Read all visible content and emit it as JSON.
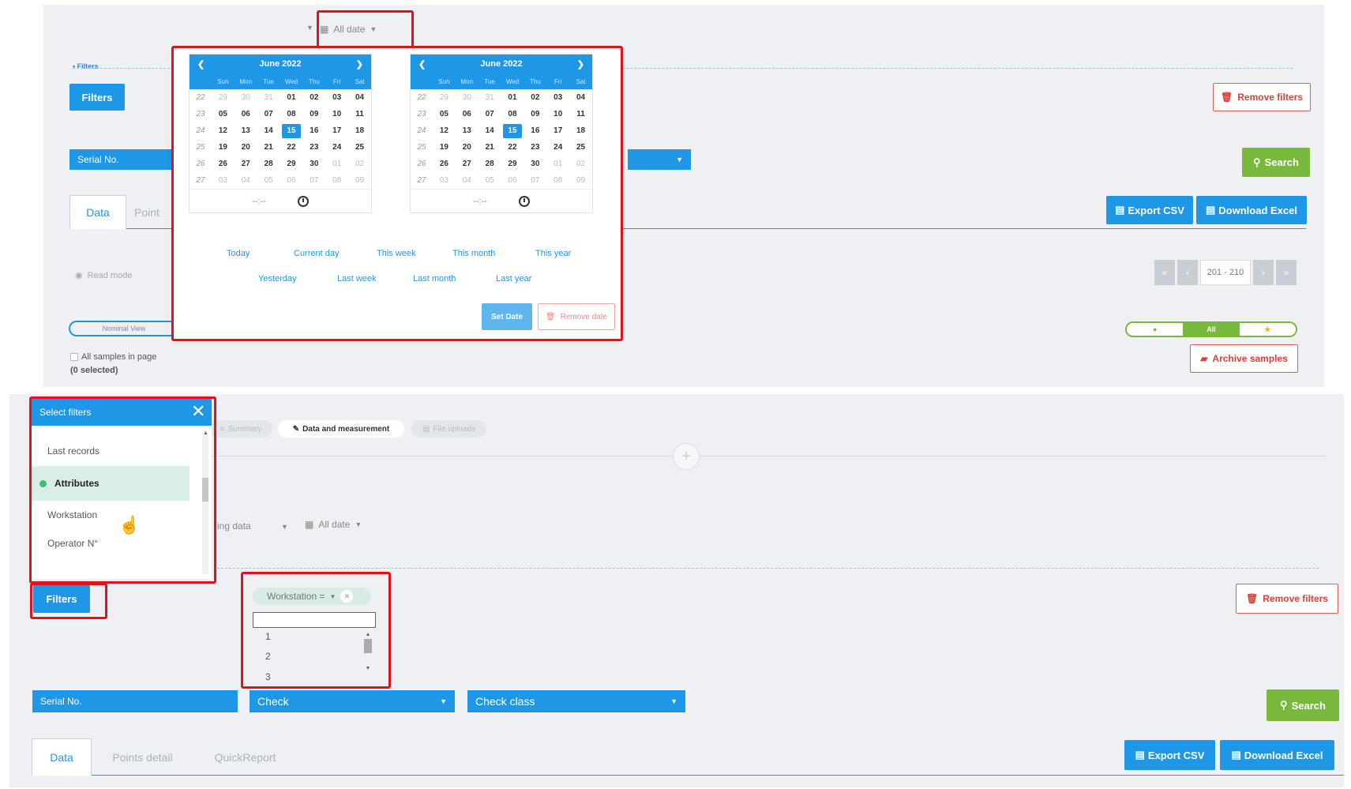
{
  "top": {
    "date_dropdown": "All date",
    "filters_caption": "• Filters",
    "filters_button": "Filters",
    "remove_filters": "Remove filters",
    "serial_no": "Serial No.",
    "search": "Search",
    "tabs": [
      "Data",
      "Point"
    ],
    "export_csv": "Export CSV",
    "download_excel": "Download Excel",
    "read_mode": "Read mode",
    "pagination": "201 - 210",
    "view_toggle": "Nominal View",
    "all_samples": "All samples in page",
    "selected_count": "(0 selected)",
    "archive_samples": "Archive samples",
    "segment": {
      "left": "●",
      "middle": "All",
      "right": "★"
    }
  },
  "calendars": [
    {
      "month": "June 2022"
    },
    {
      "month": "June 2022"
    }
  ],
  "weekday_labels": [
    "Sun",
    "Mon",
    "Tue",
    "Wed",
    "Thu",
    "Fri",
    "Sat"
  ],
  "calendar_rows": [
    {
      "wk": "22",
      "days": [
        "29",
        "30",
        "31",
        "01",
        "02",
        "03",
        "04"
      ]
    },
    {
      "wk": "23",
      "days": [
        "05",
        "06",
        "07",
        "08",
        "09",
        "10",
        "11"
      ]
    },
    {
      "wk": "24",
      "days": [
        "12",
        "13",
        "14",
        "15",
        "16",
        "17",
        "18"
      ]
    },
    {
      "wk": "25",
      "days": [
        "19",
        "20",
        "21",
        "22",
        "23",
        "24",
        "25"
      ]
    },
    {
      "wk": "26",
      "days": [
        "26",
        "27",
        "28",
        "29",
        "30",
        "01",
        "02"
      ]
    },
    {
      "wk": "27",
      "days": [
        "03",
        "04",
        "05",
        "06",
        "07",
        "08",
        "09"
      ]
    }
  ],
  "selected_day": "15",
  "time_placeholder": "--:--",
  "quick_ranges": {
    "row1": [
      "Today",
      "Current day",
      "This week",
      "This month",
      "This year"
    ],
    "row2": [
      "Yesterday",
      "Last week",
      "Last month",
      "Last year"
    ]
  },
  "set_date": "Set Date",
  "remove_date": "Remove date",
  "bottom": {
    "select_filters_title": "Select filters",
    "menu_items": [
      "Last records",
      "Attributes",
      "Workstation",
      "Operator N°"
    ],
    "pills": [
      "Summary",
      "Data and measurement",
      "File uploads"
    ],
    "sort_label": "ing data",
    "date_dropdown": "All date",
    "filters_button": "Filters",
    "workstation_chip": "Workstation =",
    "workstation_options": [
      "1",
      "2",
      "3"
    ],
    "remove_filters": "Remove filters",
    "serial_no": "Serial No.",
    "check": "Check",
    "check_class": "Check class",
    "search": "Search",
    "tabs": [
      "Data",
      "Points detail",
      "QuickReport"
    ],
    "export_csv": "Export CSV",
    "download_excel": "Download Excel"
  },
  "colors": {
    "accent": "#1e98e6",
    "success": "#78b83c",
    "danger": "#d9423a",
    "highlight": "#e0121e"
  }
}
